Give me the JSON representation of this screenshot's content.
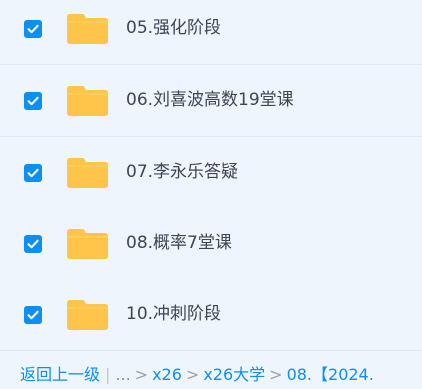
{
  "folders": [
    {
      "name": "05.强化阶段",
      "checked": true
    },
    {
      "name": "06.刘喜波高数19堂课",
      "checked": true
    },
    {
      "name": "07.李永乐答疑",
      "checked": true
    },
    {
      "name": "08.概率7堂课",
      "checked": true
    },
    {
      "name": "10.冲刺阶段",
      "checked": true
    }
  ],
  "breadcrumb": {
    "back_label": "返回上一级",
    "divider": "|",
    "ellipsis": "...",
    "separator": ">",
    "items": [
      "x26",
      "x26大学",
      "08.【2024."
    ]
  },
  "colors": {
    "accent": "#0b8ff3",
    "folder": "#ffc54a",
    "text": "#3e4453",
    "background": "#eef5fd"
  },
  "icons": {
    "checkbox": "checkbox-checked-icon",
    "folder": "folder-icon"
  }
}
